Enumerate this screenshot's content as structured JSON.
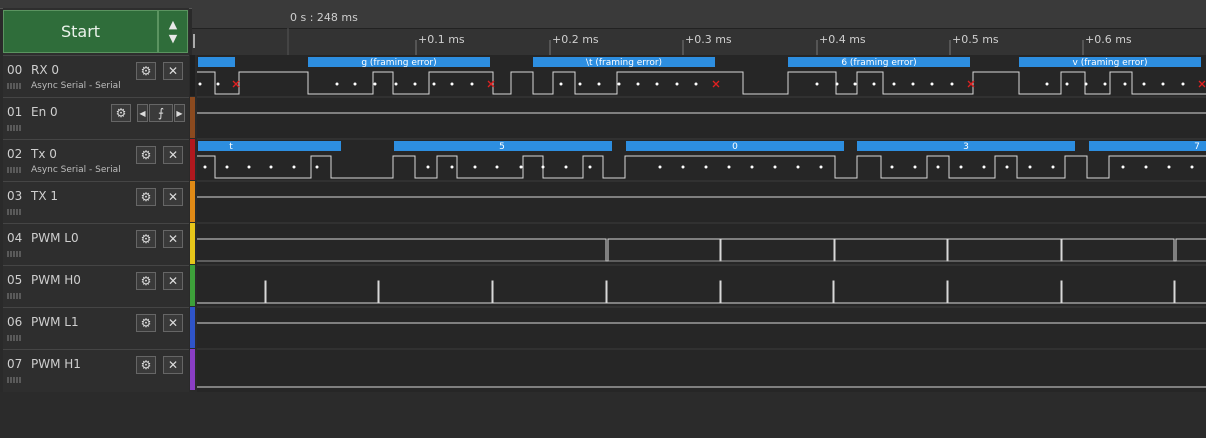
{
  "start_label": "Start",
  "arrows": {
    "up": "▲",
    "down": "▼"
  },
  "ruler": {
    "cursor": "0 s : 248 ms",
    "ticks": [
      "+0.1 ms",
      "+0.2 ms",
      "+0.3 ms",
      "+0.4 ms",
      "+0.5 ms",
      "+0.6 ms"
    ]
  },
  "channels": [
    {
      "num": "00",
      "name": "RX 0",
      "sub": "Async Serial - Serial",
      "color": "#1f1f1f"
    },
    {
      "num": "01",
      "name": "En 0",
      "sub": "",
      "color": "#8b4a1f"
    },
    {
      "num": "02",
      "name": "Tx 0",
      "sub": "Async Serial - Serial",
      "color": "#b0181e"
    },
    {
      "num": "03",
      "name": "TX 1",
      "sub": "",
      "color": "#e08a16"
    },
    {
      "num": "04",
      "name": "PWM L0",
      "sub": "",
      "color": "#e6c51a"
    },
    {
      "num": "05",
      "name": "PWM H0",
      "sub": "",
      "color": "#3da03a"
    },
    {
      "num": "06",
      "name": "PWM L1",
      "sub": "",
      "color": "#2f54c8"
    },
    {
      "num": "07",
      "name": "PWM H1",
      "sub": "",
      "color": "#8a3ec4"
    }
  ],
  "en0_buttons": {
    "prev": "◀",
    "edge": "⨍",
    "next": "▶"
  },
  "icons": {
    "settings": "gear-icon",
    "close": "close-icon"
  },
  "rx_frames": [
    "g (framing error)",
    "\\t (framing error)",
    "6 (framing error)",
    "v (framing error)"
  ],
  "tx_frames": [
    "t",
    "5",
    "0",
    "3",
    "7"
  ]
}
